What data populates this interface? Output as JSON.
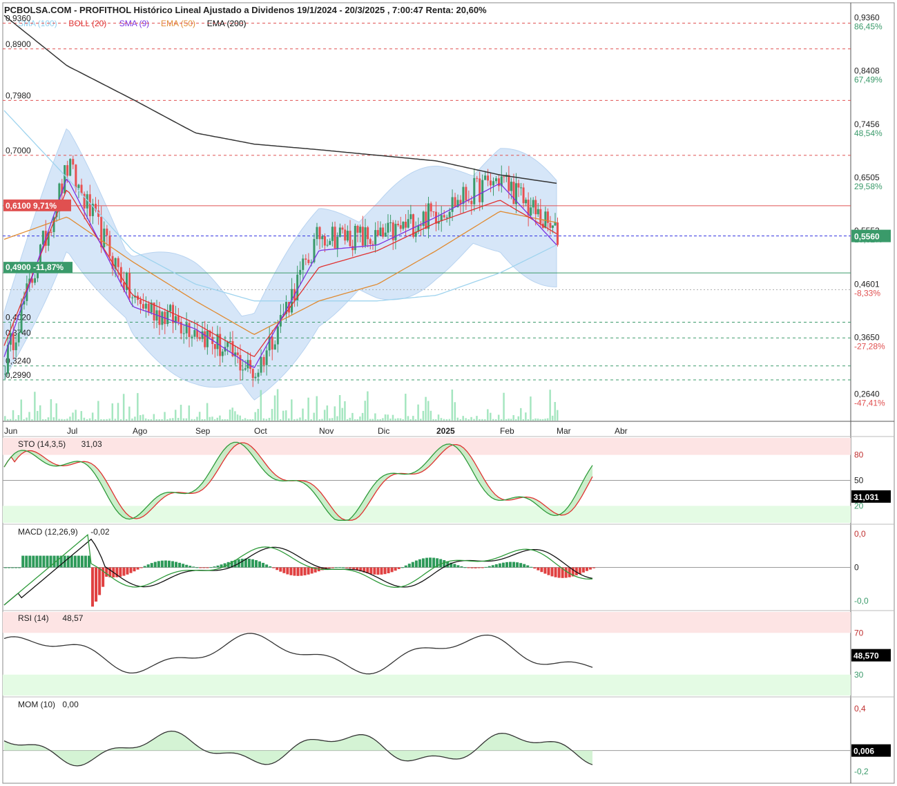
{
  "header": {
    "title": "PCBOLSA.COM - PROFITHOL Histórico Lineal Ajustado a Dividenos 19/1/2024 - 20/3/2025 , 7:00:47 Renta: 20,60%",
    "legend": [
      {
        "label": "SMA (100)",
        "color": "#8fd0f0"
      },
      {
        "label": "BOLL (20)",
        "color": "#e03030"
      },
      {
        "label": "SMA (9)",
        "color": "#7a30e0"
      },
      {
        "label": "EMA (50)",
        "color": "#e08a30"
      },
      {
        "label": "EMA (200)",
        "color": "#000000"
      }
    ]
  },
  "colors": {
    "up": "#3a9a6a",
    "down": "#e85050",
    "boll_fill": "#cfe2f7",
    "sma100": "#9ed3ee",
    "boll_mid": "#e03030",
    "sma9": "#7a30e0",
    "ema50": "#e08a30",
    "ema200": "#333333"
  },
  "price_axis": {
    "ticks": [
      {
        "v": 0.936,
        "label": "0,9360",
        "pct": "86,45%"
      },
      {
        "v": 0.8408,
        "label": "0,8408",
        "pct": "67,49%"
      },
      {
        "v": 0.7456,
        "label": "0,7456",
        "pct": "48,54%"
      },
      {
        "v": 0.6505,
        "label": "0,6505",
        "pct": "29,58%"
      },
      {
        "v": 0.5553,
        "label": "0,5553",
        "pct": "10,62%"
      },
      {
        "v": 0.4601,
        "label": "0,4601",
        "pct": "-8,33%"
      },
      {
        "v": 0.365,
        "label": "0,3650",
        "pct": "-27,28%"
      },
      {
        "v": 0.264,
        "label": "0,2640",
        "pct": "-47,41%"
      }
    ],
    "current": {
      "v": 0.556,
      "label": "0,5560"
    }
  },
  "levels": [
    {
      "v": 0.936,
      "label": "0,9360",
      "color": "#e05050"
    },
    {
      "v": 0.89,
      "label": "0,8900",
      "color": "#e05050"
    },
    {
      "v": 0.798,
      "label": "0,7980",
      "color": "#e05050"
    },
    {
      "v": 0.7,
      "label": "0,7000",
      "color": "#e05050"
    },
    {
      "v": 0.402,
      "label": "0,4020",
      "color": "#3a9a6a"
    },
    {
      "v": 0.374,
      "label": "0,3740",
      "color": "#3a9a6a"
    },
    {
      "v": 0.324,
      "label": "0,3240",
      "color": "#3a9a6a"
    },
    {
      "v": 0.299,
      "label": "0,2990",
      "color": "#3a9a6a"
    }
  ],
  "marks": {
    "resistance": {
      "v": 0.61,
      "label": "0,6100",
      "pct": "9,71%"
    },
    "support": {
      "v": 0.49,
      "label": "0,4900",
      "pct": "-11,87%"
    }
  },
  "months": [
    "Jun",
    "Jul",
    "Ago",
    "Sep",
    "Oct",
    "Nov",
    "Dic",
    "2025",
    "Feb",
    "Mar",
    "Abr"
  ],
  "indicators": {
    "sto": {
      "title": "STO (14,3,5)",
      "value": "31,03",
      "current": "31,031",
      "levels": [
        "80",
        "50",
        "20"
      ]
    },
    "macd": {
      "title": "MACD (12,26,9)",
      "value": "-0,02",
      "levels": [
        "0,0",
        "0",
        "-0,0"
      ]
    },
    "rsi": {
      "title": "RSI (14)",
      "value": "48,57",
      "current": "48,570",
      "levels": [
        "70",
        "30"
      ]
    },
    "mom": {
      "title": "MOM (10)",
      "value": "0,00",
      "current": "0,006",
      "levels": [
        "0,4",
        "-0,2"
      ]
    }
  },
  "chart_data": {
    "type": "line",
    "title": "PCBOLSA.COM - PROFITHOL Histórico Lineal Ajustado a Dividenos 19/1/2024 - 20/3/2025 , 7:00:47 Renta: 20,60%",
    "x": [
      "Jun",
      "Jul",
      "Ago",
      "Sep",
      "Oct",
      "Nov",
      "Dic",
      "2025",
      "Feb",
      "Mar"
    ],
    "series": [
      {
        "name": "PROFITHOL",
        "values": [
          0.33,
          0.68,
          0.44,
          0.39,
          0.31,
          0.56,
          0.55,
          0.6,
          0.66,
          0.556
        ]
      },
      {
        "name": "EMA (200)",
        "values": [
          0.95,
          0.86,
          0.8,
          0.74,
          0.72,
          0.71,
          0.7,
          0.69,
          0.665,
          0.65
        ]
      },
      {
        "name": "SMA (100)",
        "values": [
          0.78,
          0.66,
          0.53,
          0.47,
          0.44,
          0.44,
          0.44,
          0.45,
          0.49,
          0.54
        ]
      },
      {
        "name": "EMA (50)",
        "values": [
          0.55,
          0.59,
          0.51,
          0.44,
          0.38,
          0.44,
          0.47,
          0.53,
          0.6,
          0.58
        ]
      },
      {
        "name": "BOLL (20)",
        "values": [
          0.36,
          0.64,
          0.45,
          0.4,
          0.34,
          0.5,
          0.53,
          0.58,
          0.62,
          0.56
        ]
      },
      {
        "name": "SMA (9)",
        "values": [
          0.34,
          0.66,
          0.43,
          0.39,
          0.32,
          0.53,
          0.54,
          0.59,
          0.65,
          0.54
        ]
      }
    ],
    "ylim": [
      0.225,
      0.965
    ],
    "grid": false,
    "legend": "top-left"
  }
}
